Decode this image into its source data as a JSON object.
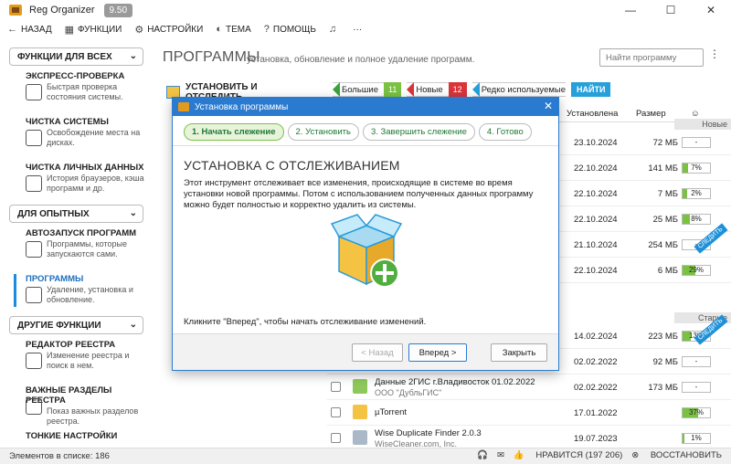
{
  "window": {
    "title": "Reg Organizer",
    "version": "9.50",
    "minimize": "—",
    "maximize": "☐",
    "close": "✕"
  },
  "toolbar": {
    "back": "НАЗАД",
    "functions": "ФУНКЦИИ",
    "settings": "НАСТРОЙКИ",
    "theme": "ТЕМА",
    "help": "ПОМОЩЬ",
    "more": "···"
  },
  "sidebar": {
    "group1": "ФУНКЦИИ ДЛЯ ВСЕХ",
    "items1": [
      {
        "title": "ЭКСПРЕСС-ПРОВЕРКА",
        "desc": "Быстрая проверка состояния системы."
      },
      {
        "title": "ЧИСТКА СИСТЕМЫ",
        "desc": "Освобождение места на дисках."
      },
      {
        "title": "ЧИСТКА ЛИЧНЫХ ДАННЫХ",
        "desc": "История браузеров, кэша программ и др."
      }
    ],
    "group2": "ДЛЯ ОПЫТНЫХ",
    "items2": [
      {
        "title": "АВТОЗАПУСК ПРОГРАММ",
        "desc": "Программы, которые запускаются сами."
      },
      {
        "title": "ПРОГРАММЫ",
        "desc": "Удаление, установка и обновление."
      }
    ],
    "group3": "ДРУГИЕ ФУНКЦИИ",
    "items3": [
      {
        "title": "РЕДАКТОР РЕЕСТРА",
        "desc": "Изменение реестра и поиск в нем."
      },
      {
        "title": "ВАЖНЫЕ РАЗДЕЛЫ РЕЕСТРА",
        "desc": "Показ важных разделов реестра."
      },
      {
        "title": "ТОНКИЕ НАСТРОЙКИ",
        "desc": ""
      }
    ]
  },
  "main": {
    "title": "ПРОГРАММЫ",
    "subtitle": "установка, обновление и полное удаление программ.",
    "search_placeholder": "Найти программу",
    "more": "⋮",
    "install_track": "УСТАНОВИТЬ И ОТСЛЕДИТЬ",
    "filters": {
      "big": "Большие",
      "big_count": "11",
      "new": "Новые",
      "new_count": "12",
      "rare": "Редко используемые",
      "find": "НАЙТИ"
    },
    "columns": {
      "installed": "Установлена",
      "size": "Размер"
    },
    "section_new": "Новые",
    "section_old": "Старые",
    "rows": [
      {
        "date": "23.10.2024",
        "size": "72 МБ",
        "rating": "-",
        "fill": 0
      },
      {
        "date": "22.10.2024",
        "size": "141 МБ",
        "rating": "7%",
        "fill": 0.07
      },
      {
        "date": "22.10.2024",
        "size": "7 МБ",
        "rating": "2%",
        "fill": 0.02
      },
      {
        "date": "22.10.2024",
        "size": "25 МБ",
        "rating": "8%",
        "fill": 0.08
      },
      {
        "date": "21.10.2024",
        "size": "254 МБ",
        "rating": "-",
        "fill": 0
      },
      {
        "date": "22.10.2024",
        "size": "6 МБ",
        "rating": "29%",
        "fill": 0.29
      }
    ],
    "rows_old": [
      {
        "date": "14.02.2024",
        "size": "223 МБ",
        "rating": "13%",
        "fill": 0.13
      },
      {
        "date": "02.02.2022",
        "size": "92 МБ",
        "rating": "-",
        "fill": 0
      },
      {
        "name": "Данные 2ГИС г.Владивосток 01.02.2022",
        "vendor": "ООО \"ДубльГИС\"",
        "date": "02.02.2022",
        "size": "173 МБ",
        "rating": "-",
        "fill": 0
      },
      {
        "name": "µTorrent",
        "vendor": "",
        "date": "17.01.2022",
        "size": "",
        "rating": "37%",
        "fill": 0.37
      },
      {
        "name": "Wise Duplicate Finder 2.0.3",
        "vendor": "WiseCleaner.com, Inc.",
        "date": "19.07.2023",
        "size": "",
        "rating": "1%",
        "fill": 0.01
      }
    ],
    "ribbon": "СЛЕДИТЬ"
  },
  "status": {
    "count": "Элементов в списке: 186",
    "likes": "НРАВИТСЯ (197 206)",
    "restore": "ВОССТАНОВИТЬ"
  },
  "dialog": {
    "title": "Установка программы",
    "close": "✕",
    "steps": [
      "1. Начать слежение",
      "2. Установить",
      "3. Завершить слежение",
      "4. Готово"
    ],
    "heading": "УСТАНОВКА С ОТСЛЕЖИВАНИЕМ",
    "body": "Этот инструмент отслеживает все изменения, происходящие в системе во время установки новой программы. Потом с использованием полученных данных программу можно будет полностью и корректно удалить из системы.",
    "hint": "Кликните \"Вперед\", чтобы начать отслеживание изменений.",
    "btn_back": "< Назад",
    "btn_next": "Вперед >",
    "btn_close": "Закрыть"
  },
  "colors": {
    "accent": "#2a7bd0",
    "green": "#7bc142",
    "red": "#d9343a"
  }
}
